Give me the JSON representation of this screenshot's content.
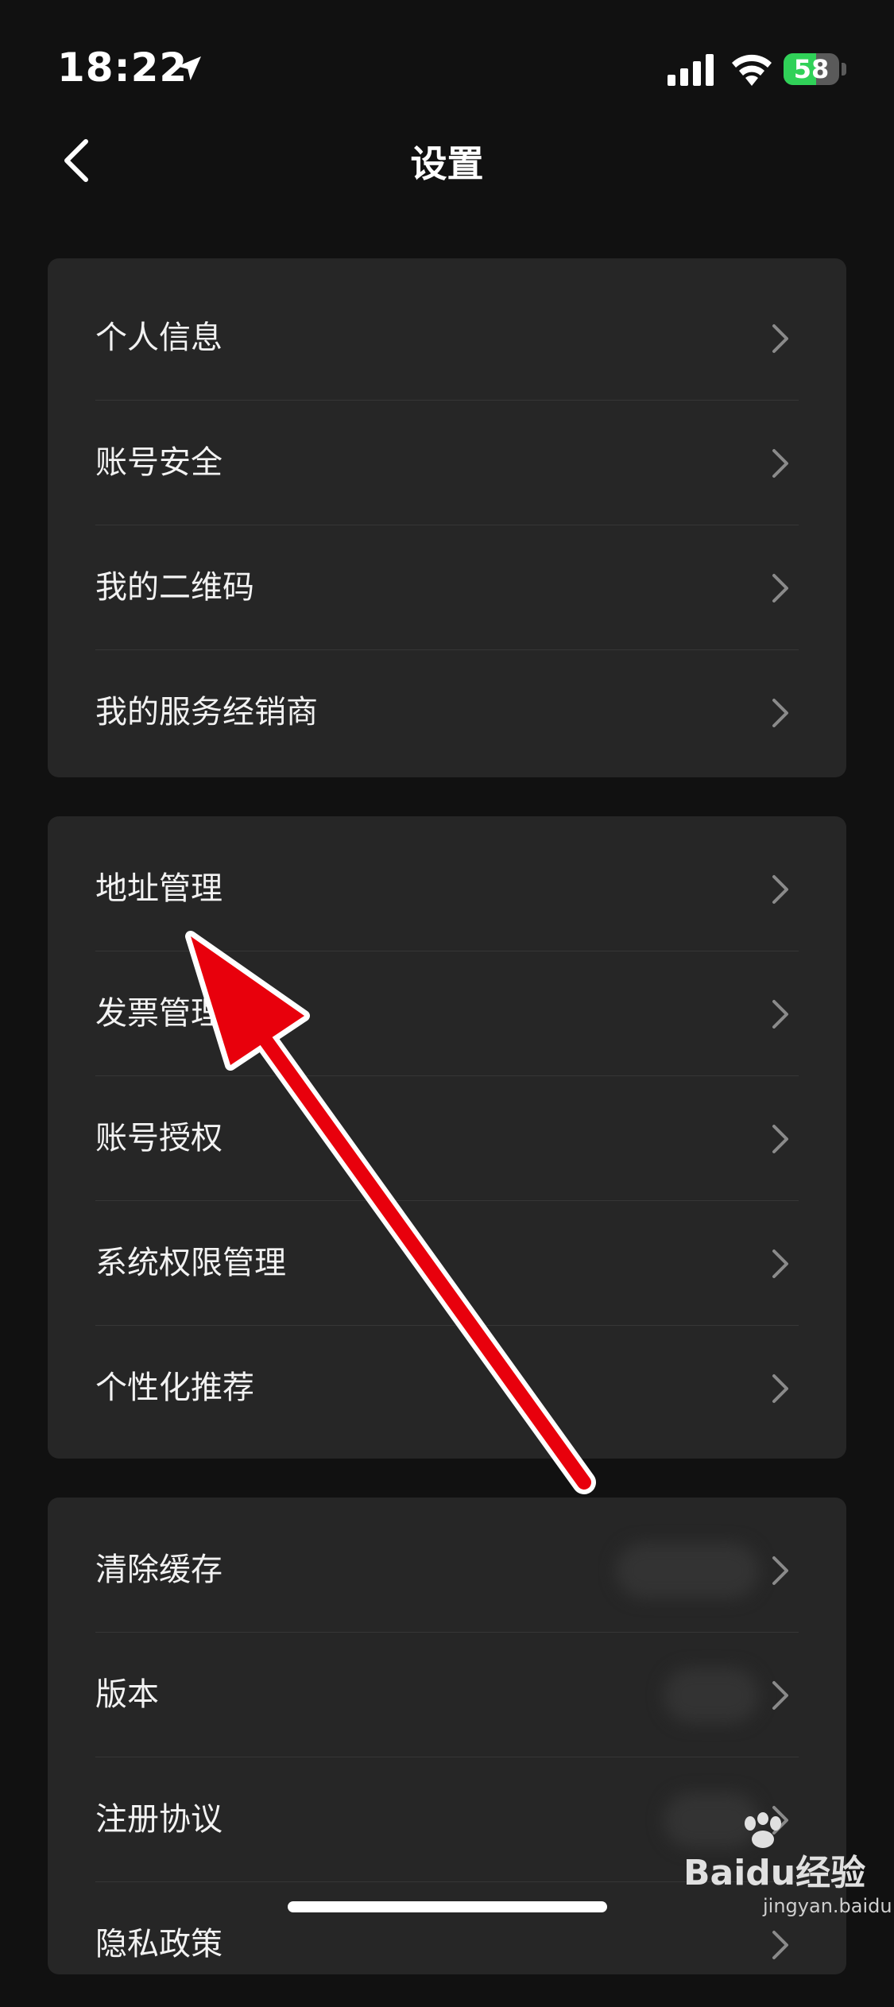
{
  "status_bar": {
    "time": "18:22",
    "battery_level": "58",
    "battery_fraction": 0.58,
    "colors": {
      "battery": "#30d158"
    },
    "icons": [
      "location-arrow-icon",
      "cellular-signal-icon",
      "wifi-icon",
      "battery-icon"
    ]
  },
  "nav": {
    "title": "设置",
    "back_icon": "chevron-left-icon"
  },
  "groups": [
    {
      "items": [
        {
          "label": "个人信息"
        },
        {
          "label": "账号安全"
        },
        {
          "label": "我的二维码"
        },
        {
          "label": "我的服务经销商"
        }
      ]
    },
    {
      "items": [
        {
          "label": "地址管理"
        },
        {
          "label": "发票管理"
        },
        {
          "label": "账号授权"
        },
        {
          "label": "系统权限管理"
        },
        {
          "label": "个性化推荐"
        }
      ]
    },
    {
      "items": [
        {
          "label": "清除缓存"
        },
        {
          "label": "版本"
        },
        {
          "label": "注册协议"
        },
        {
          "label": "隐私政策"
        }
      ]
    }
  ],
  "annotation": {
    "type": "red arrow",
    "points_to": "地址管理",
    "color": "#e8000c"
  },
  "watermark": {
    "brand": "Baidu经验",
    "url": "jingyan.baidu.com"
  },
  "theme": {
    "background": "#111111",
    "card": "#262626",
    "chevron": "#8a8a8a"
  }
}
